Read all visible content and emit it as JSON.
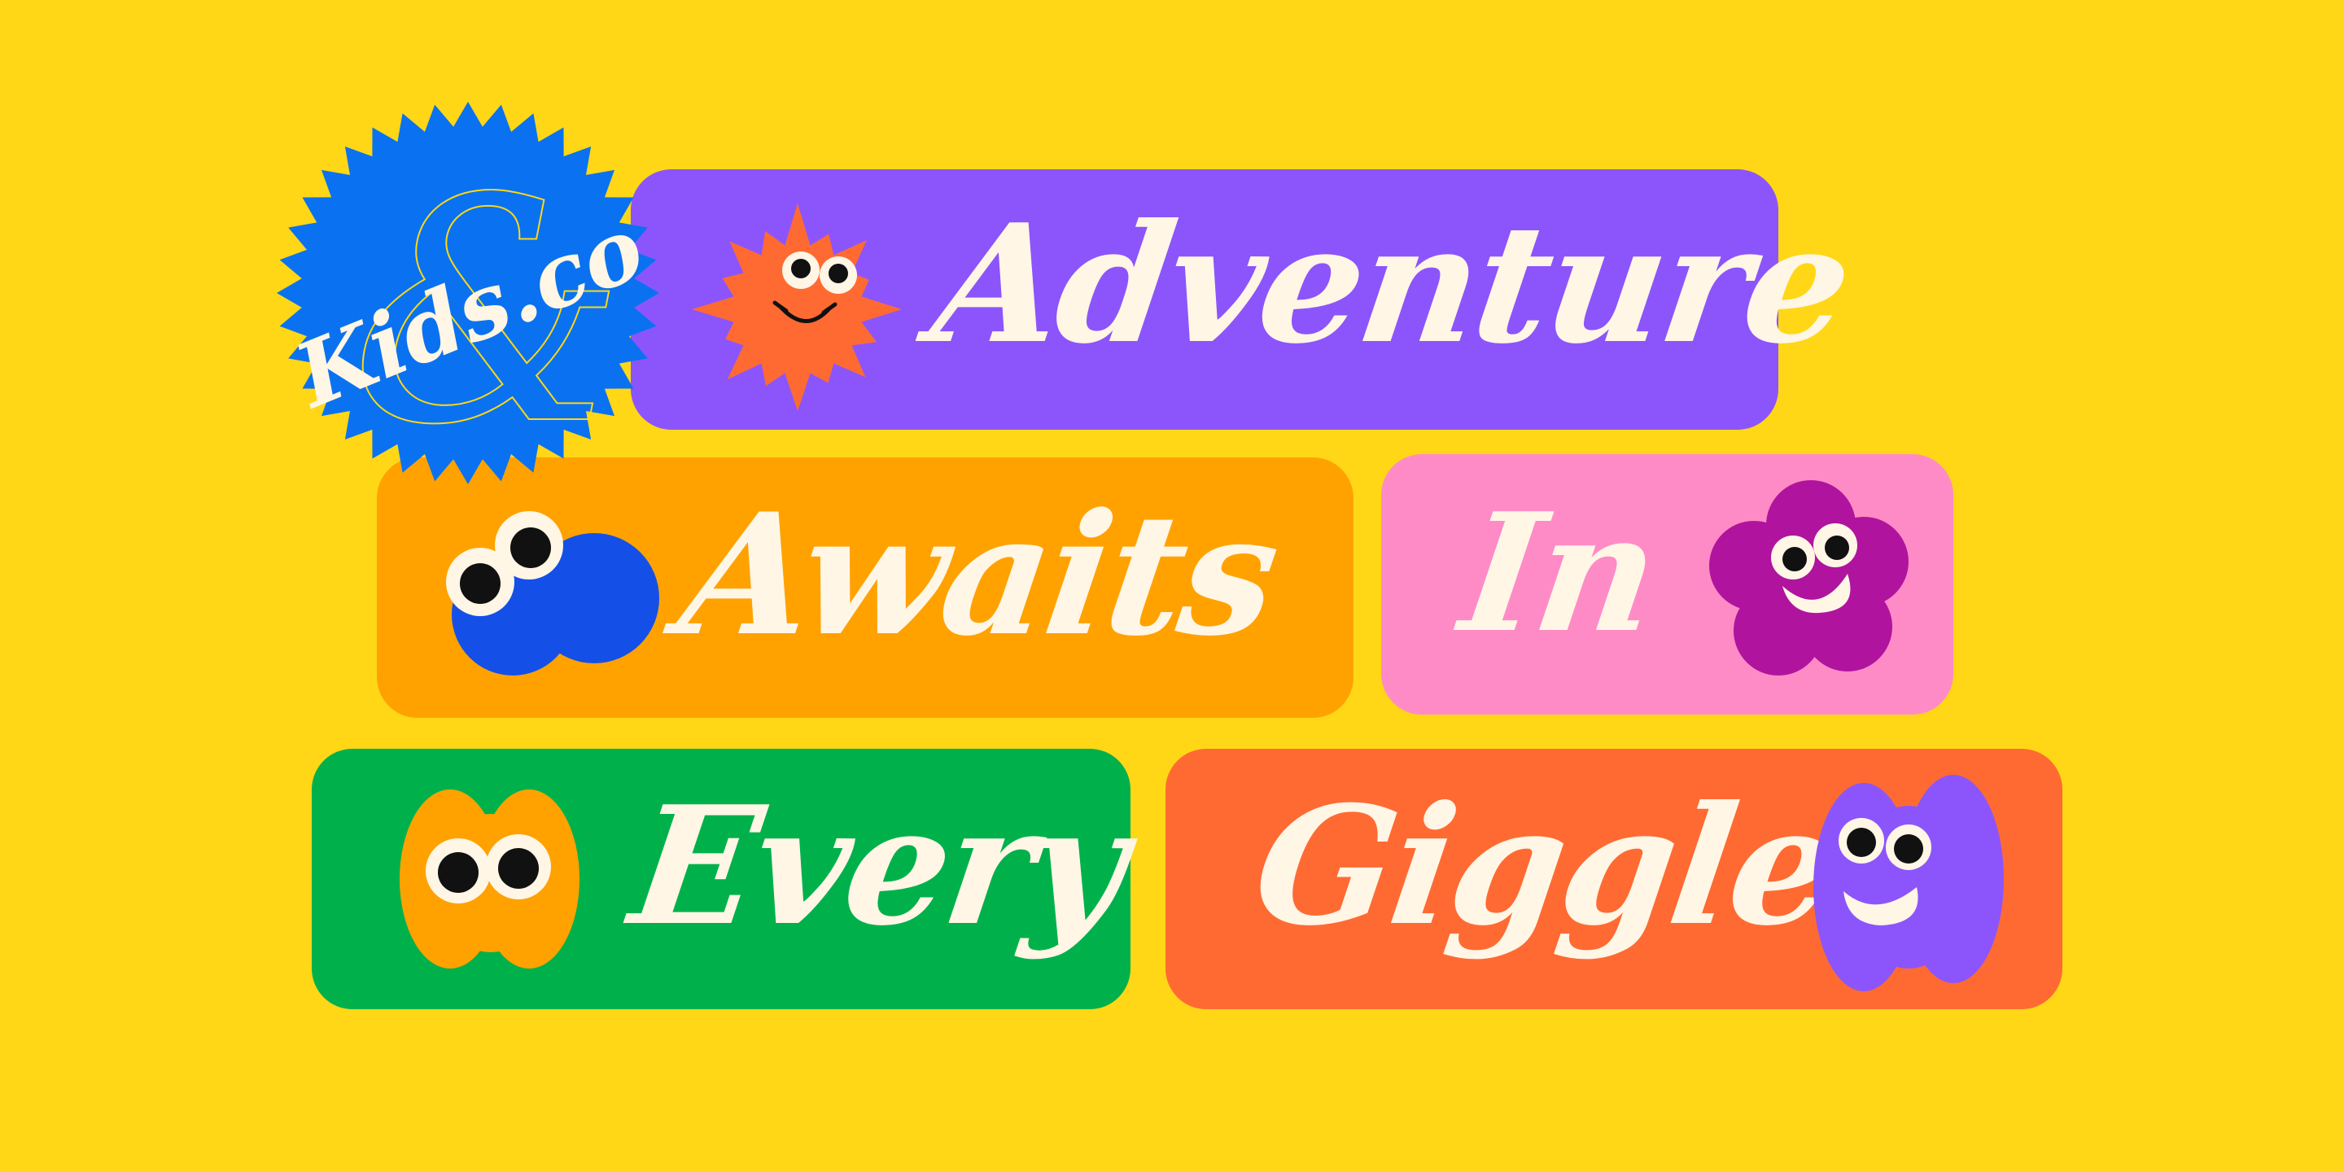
{
  "badge": {
    "text": "Kids.co",
    "color": "#0A72F0"
  },
  "lines": [
    {
      "id": "adventure",
      "text": "Adventure",
      "color": "#8C55FB"
    },
    {
      "id": "awaits",
      "text": "Awaits",
      "color": "#FFA200"
    },
    {
      "id": "in",
      "text": "In",
      "color": "#FF8BC6"
    },
    {
      "id": "every",
      "text": "Every",
      "color": "#00B14B"
    },
    {
      "id": "giggle",
      "text": "Giggle",
      "color": "#FF6A33"
    }
  ],
  "colors": {
    "background": "#FFD716",
    "text": "#FFF6E6",
    "sun": "#FF6A33",
    "blue_blob": "#1450E8",
    "flower": "#B0149E",
    "orange_blob": "#FFA200",
    "purple_blob": "#8C55FB"
  },
  "icons": [
    "sun-mascot-icon",
    "blue-blob-mascot-icon",
    "flower-mascot-icon",
    "orange-blob-mascot-icon",
    "purple-blob-mascot-icon",
    "ampersand-icon"
  ]
}
